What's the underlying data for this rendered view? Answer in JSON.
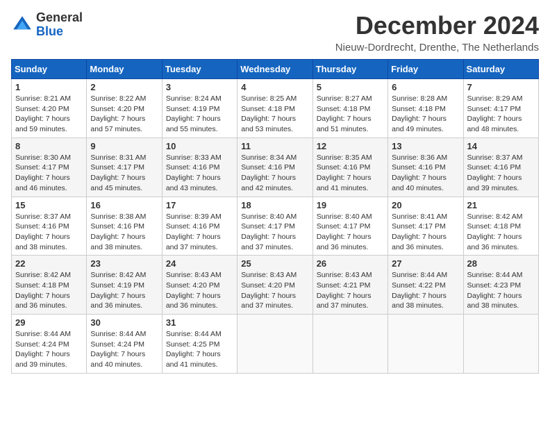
{
  "logo": {
    "general": "General",
    "blue": "Blue"
  },
  "header": {
    "month": "December 2024",
    "location": "Nieuw-Dordrecht, Drenthe, The Netherlands"
  },
  "weekdays": [
    "Sunday",
    "Monday",
    "Tuesday",
    "Wednesday",
    "Thursday",
    "Friday",
    "Saturday"
  ],
  "weeks": [
    [
      {
        "day": "1",
        "sunrise": "8:21 AM",
        "sunset": "4:20 PM",
        "daylight": "7 hours and 59 minutes."
      },
      {
        "day": "2",
        "sunrise": "8:22 AM",
        "sunset": "4:20 PM",
        "daylight": "7 hours and 57 minutes."
      },
      {
        "day": "3",
        "sunrise": "8:24 AM",
        "sunset": "4:19 PM",
        "daylight": "7 hours and 55 minutes."
      },
      {
        "day": "4",
        "sunrise": "8:25 AM",
        "sunset": "4:18 PM",
        "daylight": "7 hours and 53 minutes."
      },
      {
        "day": "5",
        "sunrise": "8:27 AM",
        "sunset": "4:18 PM",
        "daylight": "7 hours and 51 minutes."
      },
      {
        "day": "6",
        "sunrise": "8:28 AM",
        "sunset": "4:18 PM",
        "daylight": "7 hours and 49 minutes."
      },
      {
        "day": "7",
        "sunrise": "8:29 AM",
        "sunset": "4:17 PM",
        "daylight": "7 hours and 48 minutes."
      }
    ],
    [
      {
        "day": "8",
        "sunrise": "8:30 AM",
        "sunset": "4:17 PM",
        "daylight": "7 hours and 46 minutes."
      },
      {
        "day": "9",
        "sunrise": "8:31 AM",
        "sunset": "4:17 PM",
        "daylight": "7 hours and 45 minutes."
      },
      {
        "day": "10",
        "sunrise": "8:33 AM",
        "sunset": "4:16 PM",
        "daylight": "7 hours and 43 minutes."
      },
      {
        "day": "11",
        "sunrise": "8:34 AM",
        "sunset": "4:16 PM",
        "daylight": "7 hours and 42 minutes."
      },
      {
        "day": "12",
        "sunrise": "8:35 AM",
        "sunset": "4:16 PM",
        "daylight": "7 hours and 41 minutes."
      },
      {
        "day": "13",
        "sunrise": "8:36 AM",
        "sunset": "4:16 PM",
        "daylight": "7 hours and 40 minutes."
      },
      {
        "day": "14",
        "sunrise": "8:37 AM",
        "sunset": "4:16 PM",
        "daylight": "7 hours and 39 minutes."
      }
    ],
    [
      {
        "day": "15",
        "sunrise": "8:37 AM",
        "sunset": "4:16 PM",
        "daylight": "7 hours and 38 minutes."
      },
      {
        "day": "16",
        "sunrise": "8:38 AM",
        "sunset": "4:16 PM",
        "daylight": "7 hours and 38 minutes."
      },
      {
        "day": "17",
        "sunrise": "8:39 AM",
        "sunset": "4:16 PM",
        "daylight": "7 hours and 37 minutes."
      },
      {
        "day": "18",
        "sunrise": "8:40 AM",
        "sunset": "4:17 PM",
        "daylight": "7 hours and 37 minutes."
      },
      {
        "day": "19",
        "sunrise": "8:40 AM",
        "sunset": "4:17 PM",
        "daylight": "7 hours and 36 minutes."
      },
      {
        "day": "20",
        "sunrise": "8:41 AM",
        "sunset": "4:17 PM",
        "daylight": "7 hours and 36 minutes."
      },
      {
        "day": "21",
        "sunrise": "8:42 AM",
        "sunset": "4:18 PM",
        "daylight": "7 hours and 36 minutes."
      }
    ],
    [
      {
        "day": "22",
        "sunrise": "8:42 AM",
        "sunset": "4:18 PM",
        "daylight": "7 hours and 36 minutes."
      },
      {
        "day": "23",
        "sunrise": "8:42 AM",
        "sunset": "4:19 PM",
        "daylight": "7 hours and 36 minutes."
      },
      {
        "day": "24",
        "sunrise": "8:43 AM",
        "sunset": "4:20 PM",
        "daylight": "7 hours and 36 minutes."
      },
      {
        "day": "25",
        "sunrise": "8:43 AM",
        "sunset": "4:20 PM",
        "daylight": "7 hours and 37 minutes."
      },
      {
        "day": "26",
        "sunrise": "8:43 AM",
        "sunset": "4:21 PM",
        "daylight": "7 hours and 37 minutes."
      },
      {
        "day": "27",
        "sunrise": "8:44 AM",
        "sunset": "4:22 PM",
        "daylight": "7 hours and 38 minutes."
      },
      {
        "day": "28",
        "sunrise": "8:44 AM",
        "sunset": "4:23 PM",
        "daylight": "7 hours and 38 minutes."
      }
    ],
    [
      {
        "day": "29",
        "sunrise": "8:44 AM",
        "sunset": "4:24 PM",
        "daylight": "7 hours and 39 minutes."
      },
      {
        "day": "30",
        "sunrise": "8:44 AM",
        "sunset": "4:24 PM",
        "daylight": "7 hours and 40 minutes."
      },
      {
        "day": "31",
        "sunrise": "8:44 AM",
        "sunset": "4:25 PM",
        "daylight": "7 hours and 41 minutes."
      },
      null,
      null,
      null,
      null
    ]
  ]
}
